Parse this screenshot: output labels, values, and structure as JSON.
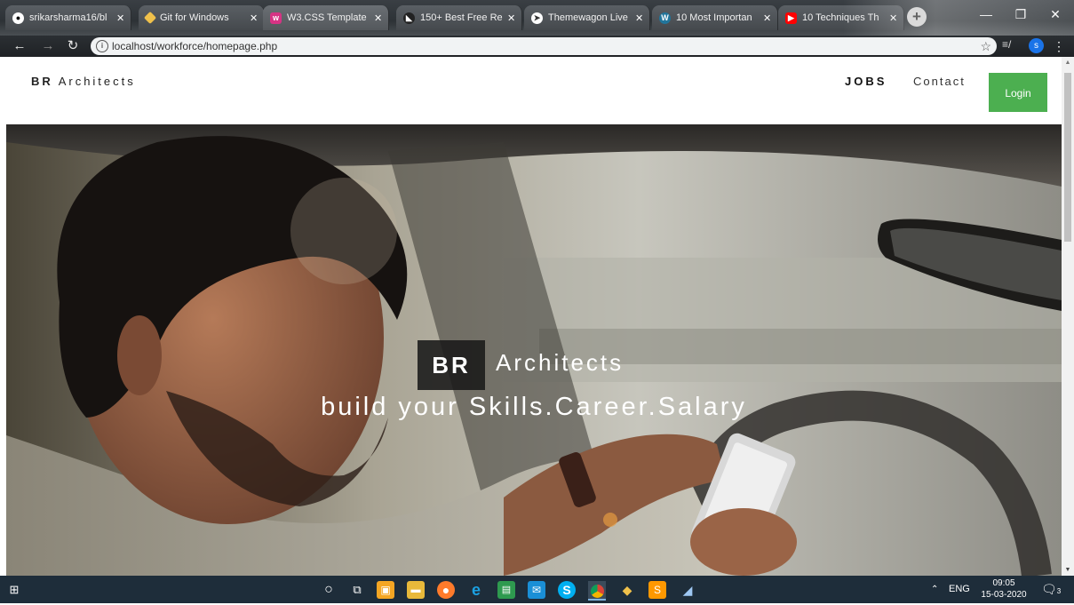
{
  "browser": {
    "tabs": [
      {
        "title": "srikarsharma16/bl",
        "favicon": "github-icon",
        "color": "#ffffff"
      },
      {
        "title": "Git for Windows",
        "favicon": "git-icon",
        "color": "#f0c14b"
      },
      {
        "title": "W3.CSS Template",
        "favicon": "w3css-icon",
        "color": "#d63384"
      },
      {
        "title": "150+ Best Free Re",
        "favicon": "template-icon",
        "color": "#222222"
      },
      {
        "title": "Themewagon Live",
        "favicon": "themewagon-icon",
        "color": "#ffffff"
      },
      {
        "title": "10 Most Importan",
        "favicon": "wordpress-icon",
        "color": "#21759b"
      },
      {
        "title": "10 Techniques Th",
        "favicon": "youtube-icon",
        "color": "#ff0000"
      }
    ],
    "url": "localhost/workforce/homepage.php",
    "profile_initial": "s"
  },
  "navbar": {
    "brand_bold": "BR",
    "brand_rest": "Architects",
    "links": [
      "JOBS",
      "Contact"
    ],
    "login_label": "Login"
  },
  "hero": {
    "badge": "BR",
    "title": "Architects",
    "tagline": "build your Skills.Career.Salary"
  },
  "taskbar": {
    "language": "ENG",
    "time": "09:05",
    "date": "15-03-2020",
    "notifications": "3"
  },
  "colors": {
    "login_bg": "#4caf50",
    "taskbar_bg": "#1e2d3a"
  }
}
